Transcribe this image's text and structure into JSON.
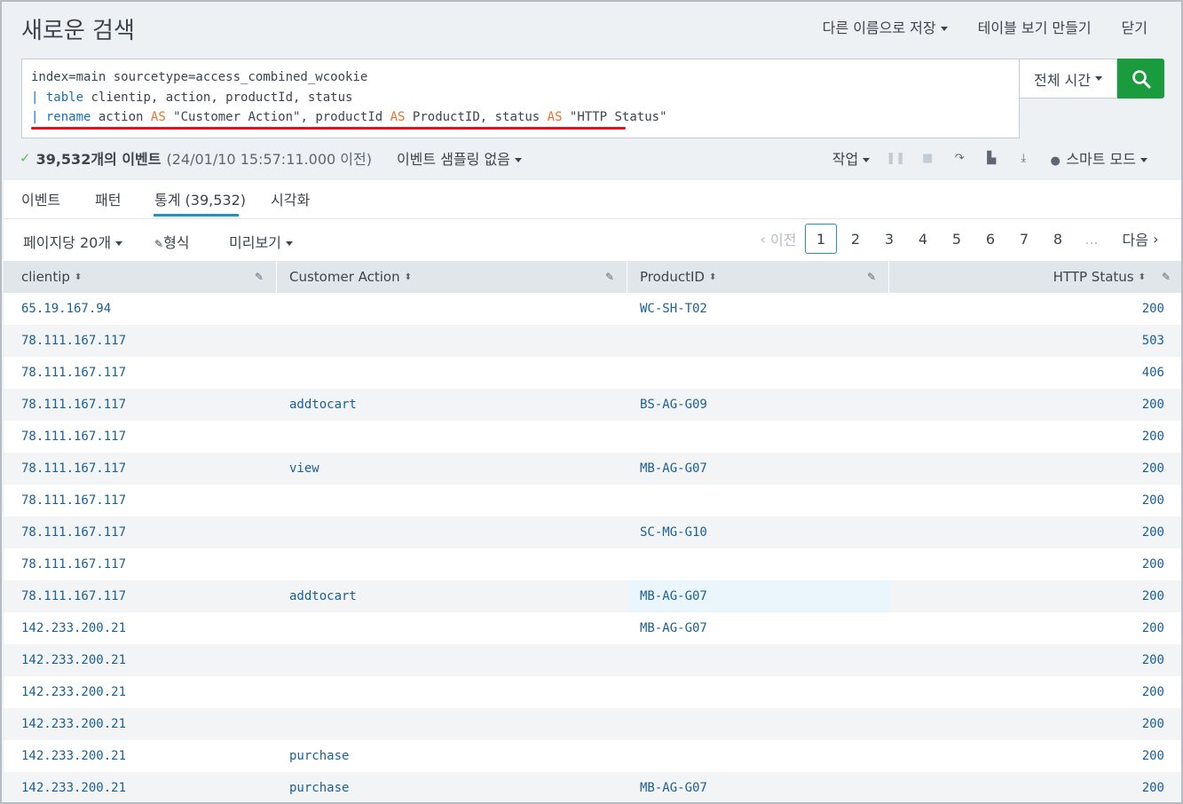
{
  "header": {
    "title": "새로운 검색",
    "save_as": "다른 이름으로 저장",
    "create_table_view": "테이블 보기 만들기",
    "close": "닫기"
  },
  "search": {
    "lines": [
      {
        "pipe": "",
        "cmd": "",
        "text": "index=main sourcetype=access_combined_wcookie"
      },
      {
        "pipe": "|",
        "cmd": "table",
        "text": " clientip, action, productId, status"
      }
    ],
    "rename_line": {
      "pipe": "|",
      "cmd": "rename",
      "p1": " action ",
      "as1": "AS",
      "p2": " \"Customer Action\", productId ",
      "as2": "AS",
      "p3": " ProductID, status ",
      "as3": "AS",
      "p4": " \"HTTP Status\""
    },
    "time_range": "전체 시간",
    "search_button_icon": "search-icon"
  },
  "status": {
    "count": "39,532개의 이벤트",
    "time": "(24/01/10 15:57:11.000 이전)",
    "sampling": "이벤트 샘플링 없음",
    "job": "작업",
    "mode": "스마트 모드"
  },
  "tabs": [
    "이벤트",
    "패턴",
    "통계 (39,532)",
    "시각화"
  ],
  "toolbar": {
    "per_page": "페이지당 20개",
    "format": "형식",
    "preview": "미리보기"
  },
  "pager": {
    "prev": "이전",
    "pages": [
      "1",
      "2",
      "3",
      "4",
      "5",
      "6",
      "7",
      "8"
    ],
    "ellipsis": "...",
    "next": "다음"
  },
  "table": {
    "columns": [
      "clientip",
      "Customer Action",
      "ProductID",
      "HTTP Status"
    ],
    "rows": [
      [
        "65.19.167.94",
        "",
        "WC-SH-T02",
        "200"
      ],
      [
        "78.111.167.117",
        "",
        "",
        "503"
      ],
      [
        "78.111.167.117",
        "",
        "",
        "406"
      ],
      [
        "78.111.167.117",
        "addtocart",
        "BS-AG-G09",
        "200"
      ],
      [
        "78.111.167.117",
        "",
        "",
        "200"
      ],
      [
        "78.111.167.117",
        "view",
        "MB-AG-G07",
        "200"
      ],
      [
        "78.111.167.117",
        "",
        "",
        "200"
      ],
      [
        "78.111.167.117",
        "",
        "SC-MG-G10",
        "200"
      ],
      [
        "78.111.167.117",
        "",
        "",
        "200"
      ],
      [
        "78.111.167.117",
        "addtocart",
        "MB-AG-G07",
        "200"
      ],
      [
        "142.233.200.21",
        "",
        "MB-AG-G07",
        "200"
      ],
      [
        "142.233.200.21",
        "",
        "",
        "200"
      ],
      [
        "142.233.200.21",
        "",
        "",
        "200"
      ],
      [
        "142.233.200.21",
        "",
        "",
        "200"
      ],
      [
        "142.233.200.21",
        "purchase",
        "",
        "200"
      ],
      [
        "142.233.200.21",
        "purchase",
        "MB-AG-G07",
        "200"
      ]
    ]
  },
  "colors": {
    "accent": "#1e93c6",
    "search_button": "#1a9c3e",
    "keyword_command": "#1a6fb8",
    "keyword_as": "#e8722e",
    "annotation_underline": "#e0141f"
  }
}
